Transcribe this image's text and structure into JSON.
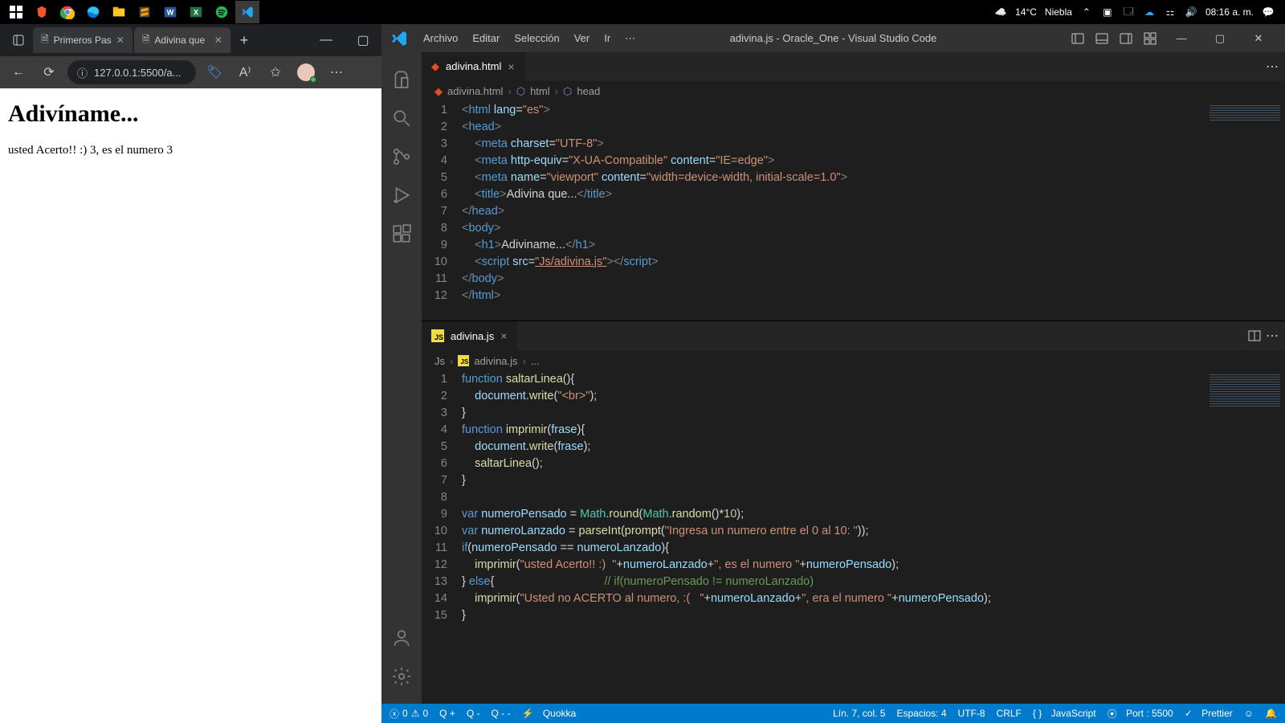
{
  "taskbar": {
    "weather_temp": "14°C",
    "weather_desc": "Niebla",
    "time": "08:16 a. m."
  },
  "browser": {
    "tab1": "Primeros Pas",
    "tab2": "Adivina que",
    "url": "127.0.0.1:5500/a...",
    "page_h1": "Adivíname...",
    "page_text": "usted Acerto!! :) 3, es el numero 3"
  },
  "vscode": {
    "menu": {
      "archivo": "Archivo",
      "editar": "Editar",
      "seleccion": "Selección",
      "ver": "Ver",
      "ir": "Ir",
      "more": "⋯"
    },
    "title": "adivina.js - Oracle_One - Visual Studio Code",
    "tab_html": "adivina.html",
    "tab_js": "adivina.js",
    "bc1_file": "adivina.html",
    "bc1_html": "html",
    "bc1_head": "head",
    "bc2_folder": "Js",
    "bc2_file": "adivina.js",
    "bc2_more": "...",
    "status": {
      "errors": "0",
      "warnings": "0",
      "qplus": "Q +",
      "qminus": "Q -",
      "qdash": "Q - -",
      "quokka": "Quokka",
      "ln": "Lín. 7, col. 5",
      "spaces": "Espacios: 4",
      "enc": "UTF-8",
      "eol": "CRLF",
      "lang": "JavaScript",
      "port": "Port : 5500",
      "prettier": "Prettier"
    }
  }
}
